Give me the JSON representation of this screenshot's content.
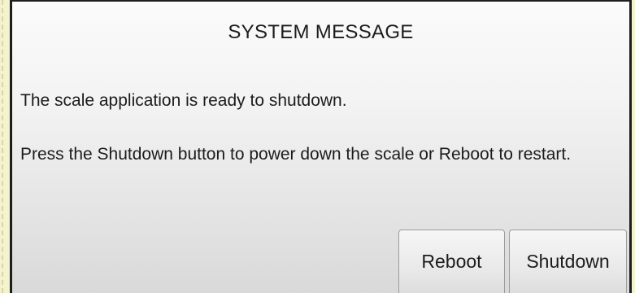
{
  "dialog": {
    "title": "SYSTEM MESSAGE",
    "message_line1": "The scale application is ready to shutdown.",
    "message_line2": "Press the Shutdown button to power down the scale or Reboot to restart."
  },
  "buttons": {
    "reboot_label": "Reboot",
    "shutdown_label": "Shutdown"
  },
  "colors": {
    "background": "#f4f3cf",
    "dialog_border": "#1e1e1e",
    "text": "#1c1c1c"
  }
}
